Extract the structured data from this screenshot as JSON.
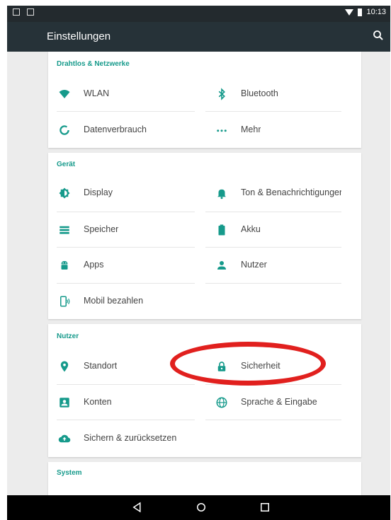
{
  "app": {
    "title": "Einstellungen"
  },
  "status": {
    "time": "10:13"
  },
  "sections": [
    {
      "title": "Drahtlos & Netzwerke",
      "items": [
        {
          "label": "WLAN",
          "icon": "wifi-icon"
        },
        {
          "label": "Bluetooth",
          "icon": "bluetooth-icon"
        },
        {
          "label": "Datenverbrauch",
          "icon": "data-usage-icon"
        },
        {
          "label": "Mehr",
          "icon": "more-icon"
        }
      ]
    },
    {
      "title": "Gerät",
      "items": [
        {
          "label": "Display",
          "icon": "display-icon"
        },
        {
          "label": "Ton & Benachrichtigungen",
          "icon": "bell-icon"
        },
        {
          "label": "Speicher",
          "icon": "storage-icon"
        },
        {
          "label": "Akku",
          "icon": "battery-icon"
        },
        {
          "label": "Apps",
          "icon": "android-icon"
        },
        {
          "label": "Nutzer",
          "icon": "user-icon"
        },
        {
          "label": "Mobil bezahlen",
          "icon": "mobile-pay-icon"
        }
      ]
    },
    {
      "title": "Nutzer",
      "items": [
        {
          "label": "Standort",
          "icon": "location-icon"
        },
        {
          "label": "Sicherheit",
          "icon": "lock-icon"
        },
        {
          "label": "Konten",
          "icon": "account-icon"
        },
        {
          "label": "Sprache & Eingabe",
          "icon": "globe-icon"
        },
        {
          "label": "Sichern & zurücksetzen",
          "icon": "cloud-upload-icon"
        }
      ]
    },
    {
      "title": "System",
      "items": []
    }
  ],
  "colors": {
    "accent": "#169a8b",
    "appbar": "#263238",
    "highlight": "#e1201e"
  }
}
